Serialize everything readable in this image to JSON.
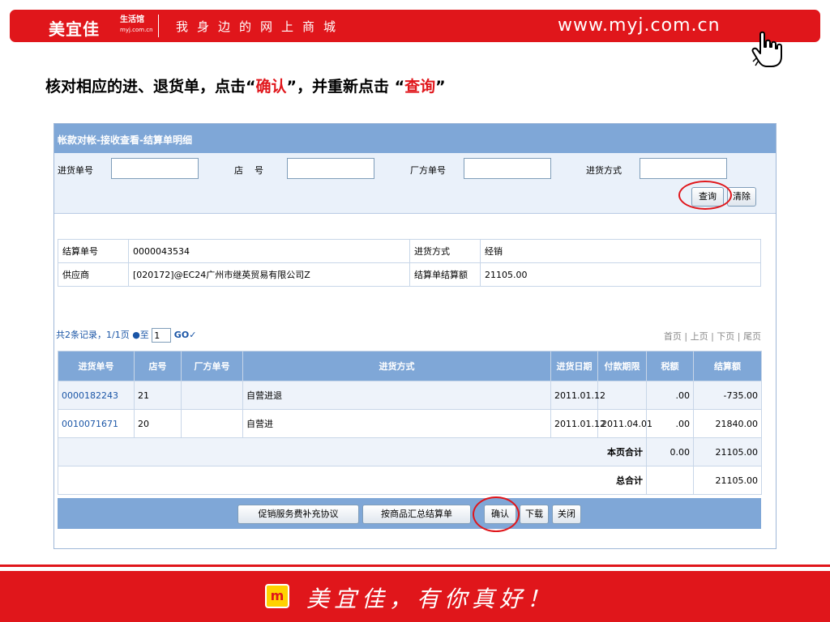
{
  "banner": {
    "brand": "美宜佳",
    "brand_sub": "生活馆",
    "brand_sub_small": "myj.com.cn",
    "slogan": "我身边的网上商城",
    "website": "www.myj.com.cn"
  },
  "instruction": {
    "prefix": "核对相应的进、退货单，点击“",
    "confirm": "确认",
    "middle": "”，并重新点击 “",
    "query": "查询",
    "suffix": "”"
  },
  "app": {
    "title": "帐款对帐-接收查看-结算单明细",
    "search": {
      "inbound_no_label": "进货单号",
      "inbound_no_value": "",
      "store_label": "店    号",
      "store_value": "",
      "vendor_no_label": "厂方单号",
      "vendor_no_value": "",
      "method_label": "进货方式",
      "method_value": "",
      "query_button": "查询",
      "clear_button": "清除"
    },
    "info": {
      "settle_no_label": "结算单号",
      "settle_no_value": "0000043534",
      "method_label": "进货方式",
      "method_value": "经销",
      "supplier_label": "供应商",
      "supplier_value": "[020172]@EC24广州市继英贸易有限公司Z",
      "amount_label": "结算单结算额",
      "amount_value": "21105.00"
    },
    "pager": {
      "summary": "共2条记录，1/1页 ●至",
      "page_input": "1",
      "go": "GO",
      "first": "首页",
      "prev": "上页",
      "next": "下页",
      "last": "尾页"
    },
    "table": {
      "headers": [
        "进货单号",
        "店号",
        "厂方单号",
        "进货方式",
        "进货日期",
        "付款期限",
        "税额",
        "结算额"
      ],
      "rows": [
        {
          "inbound_no": "0000182243",
          "store": "21",
          "vendor_no": "",
          "method": "自营进退",
          "date": "2011.01.12",
          "term": "",
          "tax": ".00",
          "amount": "-735.00"
        },
        {
          "inbound_no": "0010071671",
          "store": "20",
          "vendor_no": "",
          "method": "自营进",
          "date": "2011.01.12",
          "term": "2011.04.01",
          "tax": ".00",
          "amount": "21840.00"
        }
      ],
      "page_total_label": "本页合计",
      "page_total_tax": "0.00",
      "page_total_amount": "21105.00",
      "grand_total_label": "总合计",
      "grand_total_amount": "21105.00"
    },
    "actions": {
      "promo_agreement": "促销服务费补充协议",
      "by_product": "按商品汇总结算单",
      "confirm": "确认",
      "download": "下载",
      "close": "关闭"
    }
  },
  "footer": {
    "logo": "m",
    "slogan": "美宜佳，有你真好！"
  },
  "colors": {
    "brand_red": "#e0161b",
    "header_blue": "#7fa7d7",
    "link_blue": "#1a55a6"
  }
}
